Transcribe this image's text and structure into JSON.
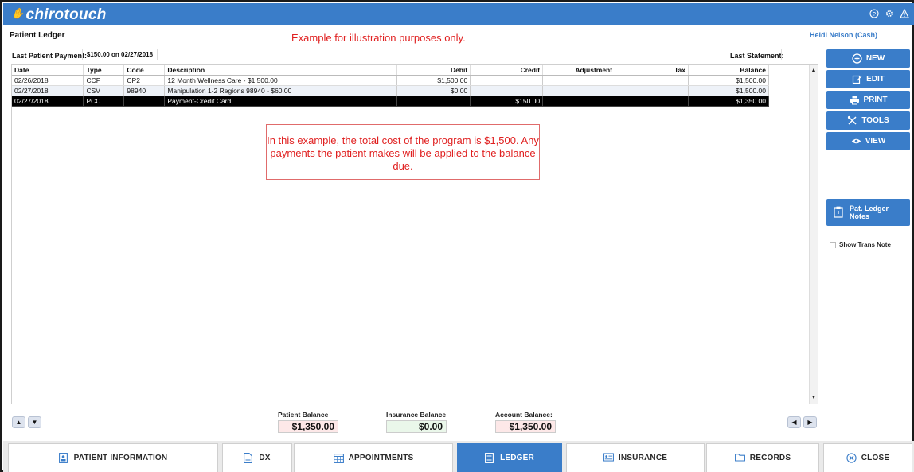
{
  "app": {
    "logo_text": "chirotouch",
    "user": "Heidi Nelson (Cash)",
    "page_title": "Patient Ledger"
  },
  "banner": "Example for illustration purposes only.",
  "top_icons": [
    "help-circle-icon",
    "gear-icon",
    "warning-triangle-icon"
  ],
  "last_payment": {
    "label": "Last Patient Payment:",
    "value": "$150.00 on 02/27/2018"
  },
  "last_statement": {
    "label": "Last Statement:",
    "value": ""
  },
  "ledger": {
    "columns": [
      "Date",
      "Type",
      "Code",
      "Description",
      "Debit",
      "Credit",
      "Adjustment",
      "Tax",
      "Balance"
    ],
    "rows": [
      {
        "date": "02/26/2018",
        "type": "CCP",
        "code": "CP2",
        "description": "12 Month Wellness Care - $1,500.00",
        "debit": "$1,500.00",
        "credit": "",
        "adjustment": "",
        "tax": "",
        "balance": "$1,500.00"
      },
      {
        "date": "02/27/2018",
        "type": "CSV",
        "code": "98940",
        "description": "Manipulation 1-2 Regions 98940 - $60.00",
        "debit": "$0.00",
        "credit": "",
        "adjustment": "",
        "tax": "",
        "balance": "$1,500.00"
      },
      {
        "date": "02/27/2018",
        "type": "PCC",
        "code": "",
        "description": "Payment-Credit Card",
        "debit": "",
        "credit": "$150.00",
        "adjustment": "",
        "tax": "",
        "balance": "$1,350.00"
      }
    ]
  },
  "callout": "In this example, the total cost of the program is $1,500. Any payments the patient makes will be applied to the balance due.",
  "side_buttons": {
    "new": "NEW",
    "edit": "EDIT",
    "print": "PRINT",
    "tools": "TOOLS",
    "view": "VIEW"
  },
  "notes_button": {
    "line1": "Pat. Ledger",
    "line2": "Notes"
  },
  "show_trans_note": "Show Trans Note",
  "balances": {
    "patient": {
      "label": "Patient Balance",
      "value": "$1,350.00"
    },
    "insurance": {
      "label": "Insurance Balance",
      "value": "$0.00"
    },
    "account": {
      "label": "Account Balance:",
      "value": "$1,350.00"
    }
  },
  "bottom_tabs": {
    "patient_information": "PATIENT INFORMATION",
    "dx": "DX",
    "appointments": "APPOINTMENTS",
    "ledger": "LEDGER",
    "insurance": "INSURANCE",
    "records": "RECORDS",
    "close": "CLOSE"
  },
  "colors": {
    "accent": "#3a7dc9",
    "alert_red": "#e02020",
    "patient_balance_bg": "#fde8e8",
    "insurance_balance_bg": "#eaf7ea",
    "selected_row": "#000000"
  }
}
